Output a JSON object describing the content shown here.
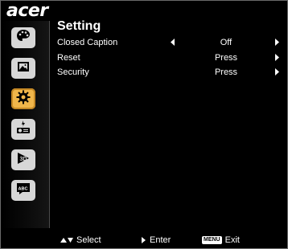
{
  "brand": {
    "logo_text": "acer"
  },
  "sidebar": {
    "tabs": [
      {
        "icon": "palette-icon",
        "active": false
      },
      {
        "icon": "image-icon",
        "active": false
      },
      {
        "icon": "gear-icon",
        "active": true
      },
      {
        "icon": "projector-power-icon",
        "active": false
      },
      {
        "icon": "3d-icon",
        "active": false
      },
      {
        "icon": "abc-language-icon",
        "active": false,
        "label": "ABC"
      }
    ]
  },
  "main": {
    "title": "Setting",
    "rows": [
      {
        "label": "Closed Caption",
        "value": "Off"
      },
      {
        "label": "Reset",
        "value": "Press"
      },
      {
        "label": "Security",
        "value": "Press"
      }
    ]
  },
  "footer": {
    "select_label": "Select",
    "enter_label": "Enter",
    "menu_key": "MENU",
    "exit_label": "Exit"
  },
  "colors": {
    "active_tab": "#f0b64a",
    "inactive_tab": "#d7d7d7",
    "background": "#000000"
  }
}
